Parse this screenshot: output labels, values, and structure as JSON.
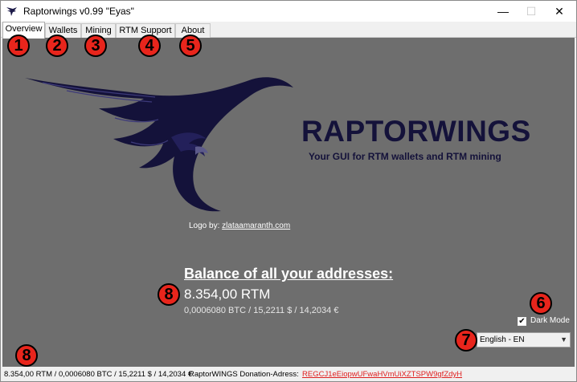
{
  "window": {
    "title": "Raptorwings v0.99 \"Eyas\"",
    "minimize_glyph": "—",
    "maximize_glyph": "☐",
    "close_glyph": "✕"
  },
  "tabs": [
    {
      "label": "Overview",
      "active": true
    },
    {
      "label": "Wallets",
      "active": false
    },
    {
      "label": "Mining",
      "active": false
    },
    {
      "label": "RTM Support",
      "active": false
    },
    {
      "label": "About",
      "active": false
    }
  ],
  "annotations": [
    "1",
    "2",
    "3",
    "4",
    "5",
    "6",
    "7",
    "8",
    "8"
  ],
  "logo": {
    "brand_name": "RAPTORWINGS",
    "tagline": "Your GUI for RTM wallets and RTM mining",
    "icon": "raptor-logo",
    "color": "#14123a"
  },
  "logo_credit": {
    "prefix": "Logo by:",
    "link": "zlataamaranth.com"
  },
  "balance": {
    "title": "Balance of all your addresses:",
    "rtm": "8.354,00 RTM",
    "conversions": "0,0006080 BTC / 15,2211 $ / 14,2034 €"
  },
  "dark_mode": {
    "label": "Dark Mode",
    "checked": true,
    "check_glyph": "✔"
  },
  "language": {
    "selected": "English - EN"
  },
  "statusbar": {
    "balance": "8.354,00 RTM / 0,0006080 BTC / 15,2211 $ / 14,2034 €",
    "donation_label": "RaptorWINGS Donation-Adress:",
    "donation_address": "REGCJ1eEiopwUFwaHVmUiXZTSPW9gfZdyH"
  },
  "colors": {
    "content_bg": "#6e6e6e",
    "badge": "#e8251c",
    "link_red": "#e02020"
  }
}
